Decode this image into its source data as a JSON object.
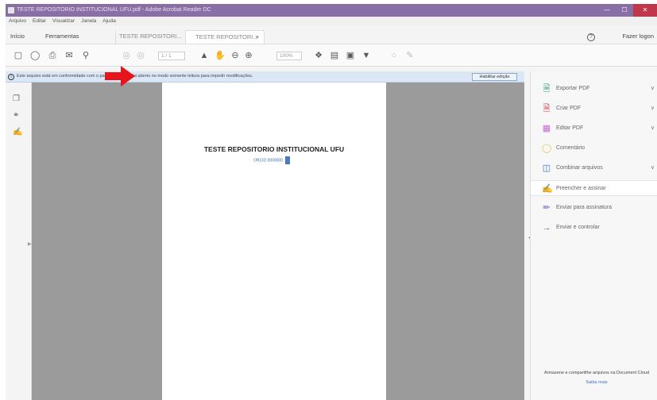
{
  "window": {
    "title": "TESTE REPOSITORIO INSTITUCIONAL UFU.pdf - Adobe Acrobat Reader DC",
    "controls": [
      "—",
      "☐",
      "✕"
    ]
  },
  "menu": [
    "Arquivo",
    "Editar",
    "Visualizar",
    "Janela",
    "Ajuda"
  ],
  "tabs": {
    "home": "Início",
    "tools": "Ferramentas",
    "doc1": "TESTE REPOSITORI...",
    "doc2": "TESTE REPOSITORI...",
    "doc2_close": "×"
  },
  "header": {
    "help": "?",
    "signin": "Fazer logon"
  },
  "toolbar": {
    "page_value": "1 / 1",
    "zoom_value": "100%"
  },
  "notice": {
    "message": "Este arquivo está em conformidade com o padrão PDF/A e foi aberto no modo somente leitura para impedir modificações.",
    "enable_button": "Habilitar edição"
  },
  "document": {
    "title": "TESTE REPOSITORIO INSTITUCIONAL UFU",
    "subtitle": "ORCID 0000000"
  },
  "tools_panel": {
    "items": [
      {
        "label": "Exportar PDF",
        "icon": "export-pdf-icon",
        "color": "#2a9a6e",
        "chevron": true
      },
      {
        "label": "Criar PDF",
        "icon": "create-pdf-icon",
        "color": "#d7373f",
        "chevron": true
      },
      {
        "label": "Editar PDF",
        "icon": "edit-pdf-icon",
        "color": "#c86bd0",
        "chevron": true
      },
      {
        "label": "Comentário",
        "icon": "comment-icon",
        "color": "#f2c14e",
        "chevron": false
      },
      {
        "label": "Combinar arquivos",
        "icon": "combine-files-icon",
        "color": "#3b73c4",
        "chevron": true
      },
      {
        "label": "Preencher e assinar",
        "icon": "fill-sign-icon",
        "color": "#7b62c9",
        "chevron": false
      },
      {
        "label": "Enviar para assinatura",
        "icon": "send-signature-icon",
        "color": "#7b62c9",
        "chevron": false
      },
      {
        "label": "Enviar e controlar",
        "icon": "send-track-icon",
        "color": "#3b73c4",
        "chevron": false
      }
    ],
    "footer_text": "Armazene e compartilhe arquivos na Document Cloud",
    "footer_link": "Saiba mais"
  },
  "colors": {
    "titlebar": "#8a6fa7",
    "notice_bg": "#dbe7f5",
    "doc_bg": "#9b9b9b",
    "red_arrow": "#e8141b"
  }
}
